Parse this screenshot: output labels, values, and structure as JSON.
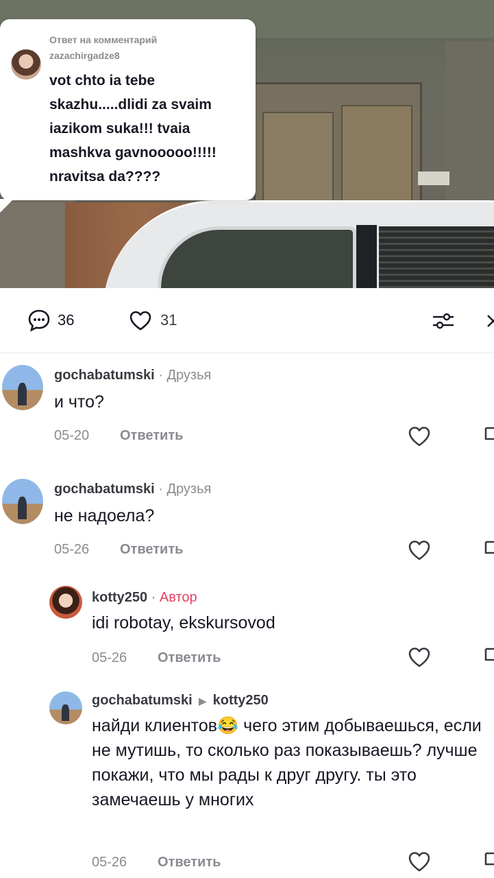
{
  "reply_bubble": {
    "header": "Ответ на комментарий",
    "username": "zazachirgadze8",
    "text": "vot chto ia tebe skazhu.....dlidi za svaim iazikom suka!!! tvaia mashkva gavnooooo!!!!! nravitsa da????"
  },
  "stats": {
    "comments_count": "36",
    "likes_count": "31",
    "comments_icon": "comment-bubble-icon",
    "likes_icon": "heart-outline-icon",
    "filter_icon": "sliders-icon",
    "close_icon": "close-icon"
  },
  "comments": [
    {
      "username": "gochabatumski",
      "tag": "· Друзья",
      "text": "и что?",
      "date": "05-20",
      "reply_label": "Ответить"
    },
    {
      "username": "gochabatumski",
      "tag": "· Друзья",
      "text": "не надоела?",
      "date": "05-26",
      "reply_label": "Ответить"
    },
    {
      "username": "kotty250",
      "tag": "· Автор",
      "text": "idi robotay, ekskursovod",
      "date": "05-26",
      "reply_label": "Ответить"
    },
    {
      "username": "gochabatumski",
      "reply_to": "kotty250",
      "text_before_emoji": "найди клиентов",
      "emoji": "😂",
      "text_after_emoji": " чего этим добываешься, если не мутишь, то сколько раз показываешь? лучше покажи, что мы рады к друг другу. ты это замечаешь у многих",
      "date": "05-26",
      "reply_label": "Ответить"
    }
  ],
  "colors": {
    "accent_author": "#e4405f",
    "text_primary": "#161823",
    "text_secondary": "#8a8b91"
  }
}
